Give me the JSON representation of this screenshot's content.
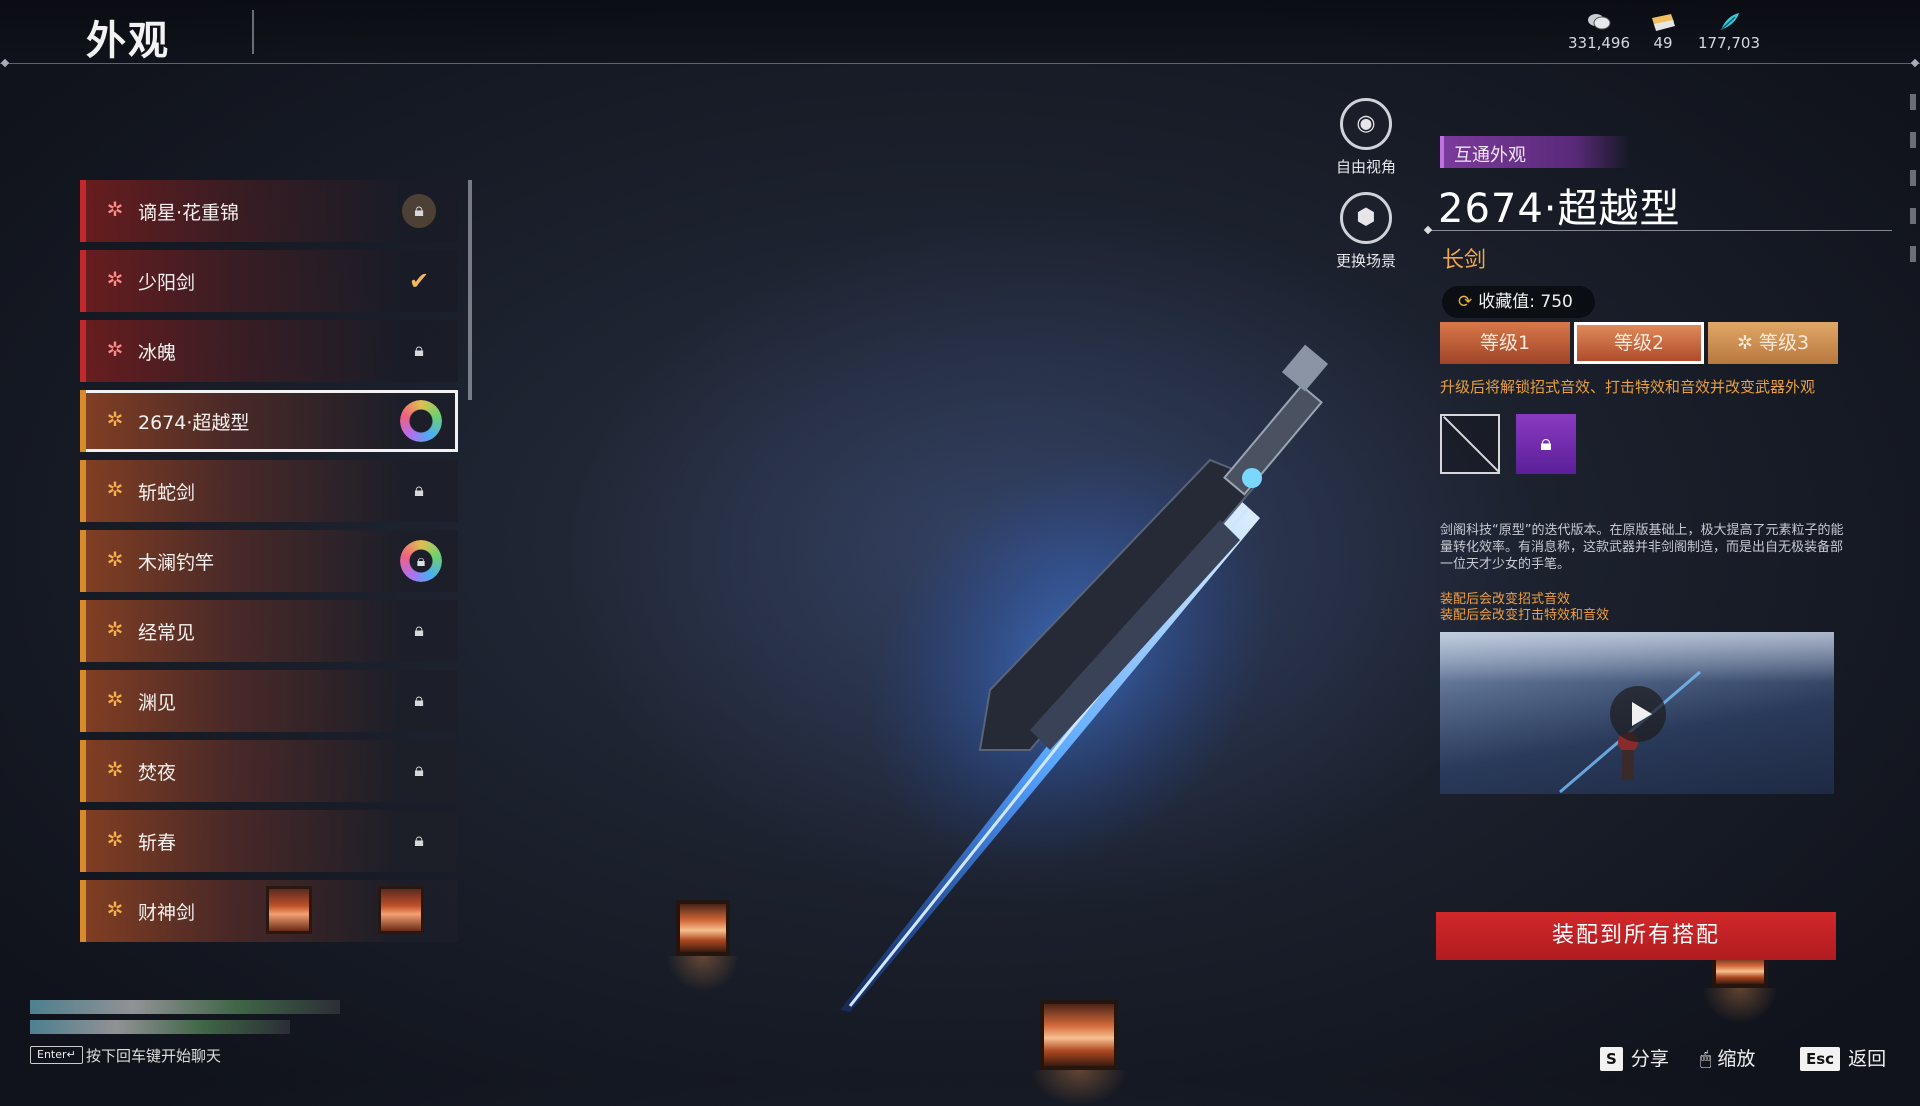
{
  "header": {
    "title": "外观",
    "currencies": [
      {
        "icon": "coin-stack-icon",
        "value": "331,496"
      },
      {
        "icon": "ticket-icon",
        "value": "49"
      },
      {
        "icon": "feather-icon",
        "value": "177,703"
      }
    ]
  },
  "skin_list": {
    "items": [
      {
        "label": "谪星·花重锦",
        "rarity": "red",
        "status": "locked"
      },
      {
        "label": "少阳剑",
        "rarity": "red",
        "status": "equipped"
      },
      {
        "label": "冰魄",
        "rarity": "red",
        "status": "locked"
      },
      {
        "label": "2674·超越型",
        "rarity": "gold",
        "status": "selected"
      },
      {
        "label": "斩蛇剑",
        "rarity": "gold",
        "status": "locked"
      },
      {
        "label": "木澜钓竿",
        "rarity": "gold",
        "status": "locked"
      },
      {
        "label": "经常见",
        "rarity": "gold",
        "status": "locked"
      },
      {
        "label": "渊见",
        "rarity": "gold",
        "status": "locked"
      },
      {
        "label": "焚夜",
        "rarity": "gold",
        "status": "locked"
      },
      {
        "label": "斩春",
        "rarity": "gold",
        "status": "locked"
      },
      {
        "label": "财神剑",
        "rarity": "gold",
        "status": "locked"
      }
    ]
  },
  "camera": {
    "free_view": "自由视角",
    "change_scene": "更换场景"
  },
  "detail": {
    "tag": "互通外观",
    "name": "2674·超越型",
    "type": "长剑",
    "collection_label": "收藏值: 750",
    "tiers": [
      "等级1",
      "等级2",
      "等级3"
    ],
    "active_tier": 2,
    "upgrade_note": "升级后将解锁招式音效、打击特效和音效并改变武器外观",
    "description": "剑阁科技“原型”的迭代版本。在原版基础上，极大提高了元素粒子的能量转化效率。有消息称，这款武器并非剑阁制造，而是出自无极装备部一位天才少女的手笔。",
    "effects": [
      "装配后会改变招式音效",
      "装配后会改变打击特效和音效"
    ],
    "equip_button": "装配到所有搭配"
  },
  "footer": {
    "enter_key": "Enter↵",
    "chat_hint": "按下回车键开始聊天",
    "share_key": "S",
    "share_label": "分享",
    "zoom_label": "缩放",
    "esc_key": "Esc",
    "back_label": "返回"
  },
  "colors": {
    "accent_red": "#c3282d",
    "accent_gold": "#d98a2a",
    "tag_purple": "#7a3a9a",
    "type_orange": "#f0a84a",
    "equip_red": "#d2282a"
  }
}
